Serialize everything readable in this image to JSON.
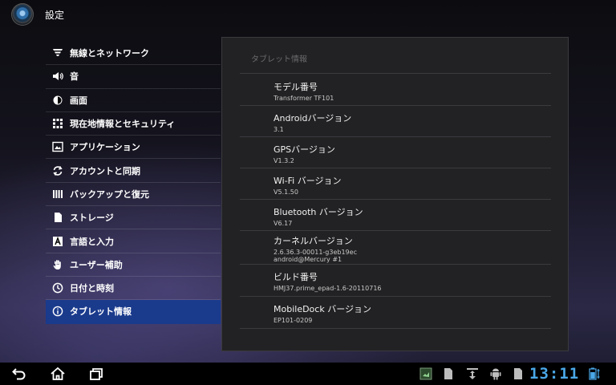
{
  "app": {
    "title": "設定",
    "icon": "settings-app-icon"
  },
  "sidebar": {
    "items": [
      {
        "label": "無線とネットワーク",
        "icon": "wifi-icon"
      },
      {
        "label": "音",
        "icon": "speaker-icon"
      },
      {
        "label": "画面",
        "icon": "brightness-icon"
      },
      {
        "label": "現在地情報とセキュリティ",
        "icon": "location-security-icon"
      },
      {
        "label": "アプリケーション",
        "icon": "applications-icon"
      },
      {
        "label": "アカウントと同期",
        "icon": "sync-icon"
      },
      {
        "label": "バックアップと復元",
        "icon": "backup-icon"
      },
      {
        "label": "ストレージ",
        "icon": "storage-icon"
      },
      {
        "label": "言語と入力",
        "icon": "language-icon"
      },
      {
        "label": "ユーザー補助",
        "icon": "accessibility-icon"
      },
      {
        "label": "日付と時刻",
        "icon": "clock-icon"
      },
      {
        "label": "タブレット情報",
        "icon": "info-icon",
        "active": true
      }
    ]
  },
  "panel": {
    "header": "タブレット情報",
    "items": [
      {
        "title": "モデル番号",
        "values": [
          "Transformer TF101"
        ]
      },
      {
        "title": "Androidバージョン",
        "values": [
          "3.1"
        ]
      },
      {
        "title": "GPSバージョン",
        "values": [
          "V1.3.2"
        ]
      },
      {
        "title": "Wi-Fi バージョン",
        "values": [
          "V5.1.50"
        ]
      },
      {
        "title": "Bluetooth バージョン",
        "values": [
          "V6.17"
        ]
      },
      {
        "title": "カーネルバージョン",
        "values": [
          "2.6.36.3-00011-g3eb19ec",
          "android@Mercury #1"
        ]
      },
      {
        "title": "ビルド番号",
        "values": [
          "HMJ37.prime_epad-1.6-20110716"
        ]
      },
      {
        "title": "MobileDock バージョン",
        "values": [
          "EP101-0209"
        ]
      }
    ]
  },
  "system_bar": {
    "clock": "13:11",
    "buttons": [
      "back-icon",
      "home-icon",
      "recent-apps-icon"
    ],
    "status_icons": [
      "screenshot-icon",
      "sd-card-icon",
      "usb-icon",
      "android-debug-icon",
      "sd-card-icon",
      "battery-icon"
    ],
    "accent_color": "#4aa8e8"
  }
}
